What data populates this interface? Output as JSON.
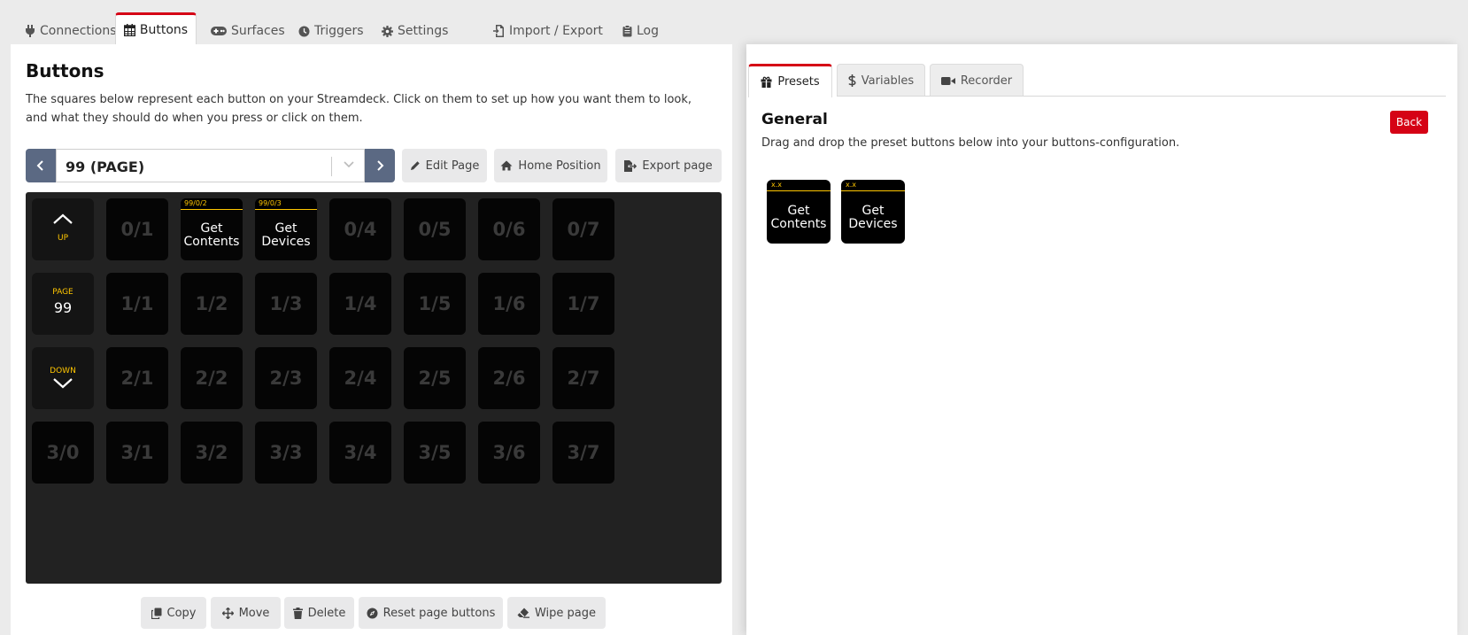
{
  "nav_tabs": [
    {
      "label": "Connections",
      "icon": "plug-icon"
    },
    {
      "label": "Buttons",
      "icon": "calendar-grid-icon",
      "active": true
    },
    {
      "label": "Surfaces",
      "icon": "gamepad-icon"
    },
    {
      "label": "Triggers",
      "icon": "clock-icon"
    },
    {
      "label": "Settings",
      "icon": "gear-icon"
    },
    {
      "label": "Import / Export",
      "icon": "file-import-icon"
    },
    {
      "label": "Log",
      "icon": "clipboard-icon"
    }
  ],
  "buttons_panel": {
    "title": "Buttons",
    "description": "The squares below represent each button on your Streamdeck. Click on them to set up how you want them to look, and what they should do when you press or click on them.",
    "page_select": {
      "value": "99 (PAGE)"
    },
    "actions": {
      "edit_page": "Edit Page",
      "home_position": "Home Position",
      "export_page": "Export page"
    },
    "grid": {
      "up_label": "UP",
      "page_label": "PAGE",
      "page_number": "99",
      "down_label": "DOWN",
      "rows": [
        [
          "",
          "0/1",
          "0/2",
          "0/3",
          "0/4",
          "0/5",
          "0/6",
          "0/7"
        ],
        [
          "",
          "1/1",
          "1/2",
          "1/3",
          "1/4",
          "1/5",
          "1/6",
          "1/7"
        ],
        [
          "",
          "2/1",
          "2/2",
          "2/3",
          "2/4",
          "2/5",
          "2/6",
          "2/7"
        ],
        [
          "3/0",
          "3/1",
          "3/2",
          "3/3",
          "3/4",
          "3/5",
          "3/6",
          "3/7"
        ]
      ],
      "configured": [
        {
          "header": "99/0/2",
          "text_line1": "Get",
          "text_line2": "Contents"
        },
        {
          "header": "99/0/3",
          "text_line1": "Get",
          "text_line2": "Devices"
        }
      ]
    },
    "bottom_actions": {
      "copy": "Copy",
      "move": "Move",
      "delete": "Delete",
      "reset": "Reset page buttons",
      "wipe": "Wipe page"
    }
  },
  "right_panel": {
    "tabs": [
      {
        "label": "Presets",
        "icon": "gift-icon",
        "active": true
      },
      {
        "label": "Variables",
        "icon": "dollar-icon"
      },
      {
        "label": "Recorder",
        "icon": "video-camera-icon"
      }
    ],
    "presets": {
      "title": "General",
      "description": "Drag and drop the preset buttons below into your buttons-configuration.",
      "back_label": "Back",
      "items": [
        {
          "header": "x.x",
          "line1": "Get",
          "line2": "Contents"
        },
        {
          "header": "x.x",
          "line1": "Get",
          "line2": "Devices"
        }
      ]
    }
  },
  "colors": {
    "accent": "#d50215",
    "page_nav": "#5b6983",
    "key_header": "#ffc600",
    "grid_background": "#222222"
  }
}
